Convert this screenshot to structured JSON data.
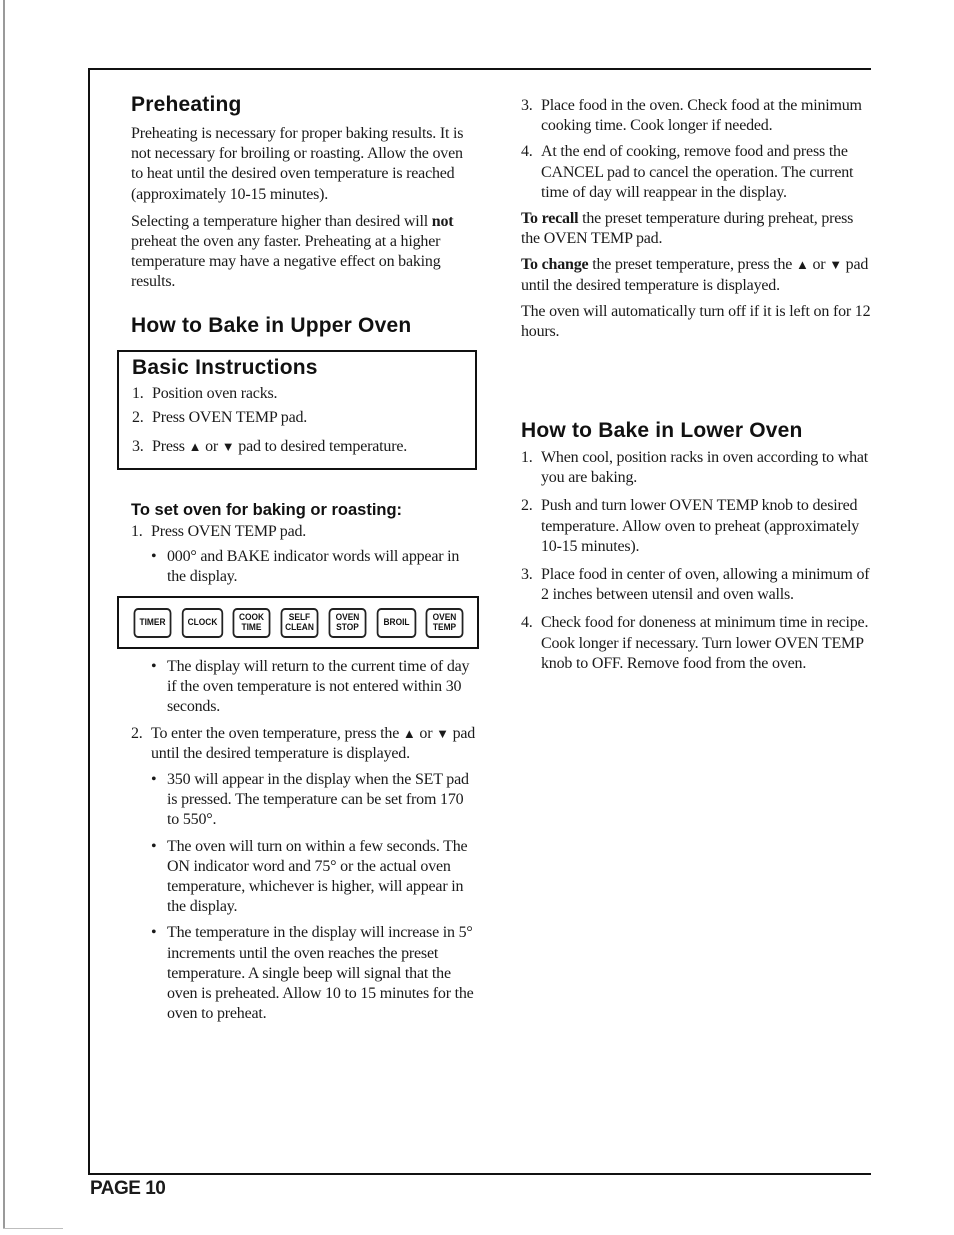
{
  "page": {
    "page_label": "PAGE 10"
  },
  "preheating": {
    "title": "Preheating",
    "para1": "Preheating is necessary for proper baking results. It is not necessary for broiling or roasting. Allow the oven to heat until the desired oven temperature is reached (approximately 10-15 minutes).",
    "para2_bold": "not",
    "para2_before": "Selecting a temperature higher than desired will ",
    "para2_after": " preheat the oven any faster. Preheating at a higher temperature may have a negative effect on baking results."
  },
  "upper_oven": {
    "title": "How to Bake in Upper Oven",
    "basic": {
      "title": "Basic Instructions",
      "steps": [
        {
          "num": "1.",
          "text": "Position oven racks."
        },
        {
          "num": "2.",
          "text": "Press OVEN TEMP pad."
        },
        {
          "num": "3.",
          "before": "Press ",
          "up": "▲",
          "mid": " or ",
          "down": "▼",
          "after": " pad to desired temperature."
        }
      ]
    },
    "set_oven": {
      "title": "To set oven for baking or roasting:",
      "step1": {
        "num": "1.",
        "text": "Press OVEN TEMP pad."
      },
      "bullet1": "000° and BAKE indicator words will appear in the display.",
      "pads": [
        {
          "line1": "TIMER",
          "line2": ""
        },
        {
          "line1": "CLOCK",
          "line2": ""
        },
        {
          "line1": "COOK",
          "line2": "TIME"
        },
        {
          "line1": "SELF",
          "line2": "CLEAN"
        },
        {
          "line1": "OVEN",
          "line2": "STOP"
        },
        {
          "line1": "BROIL",
          "line2": ""
        },
        {
          "line1": "OVEN",
          "line2": "TEMP"
        }
      ],
      "bullet2": "The display will return to the current time of day if the oven temperature is not entered within 30 seconds.",
      "step2": {
        "num": "2.",
        "before": "To enter the oven temperature, press the ",
        "up": "▲",
        "mid": " or ",
        "down": "▼",
        "after": " pad until the desired temperature is displayed."
      },
      "bullet3": "350 will appear in the display when the SET pad is pressed. The temperature can be set from 170 to 550°.",
      "bullet4": "The oven will turn on within a few seconds. The ON indicator word and 75° or the actual oven temperature, whichever is higher, will appear in the display.",
      "bullet5": "The temperature in the display will increase in 5° increments until the oven reaches the preset temperature. A single beep will signal that the oven is preheated. Allow 10 to 15 minutes for the oven to preheat.",
      "step3": {
        "num": "3.",
        "text": "Place food in the oven. Check food at the minimum cooking time. Cook longer if needed."
      },
      "step4": {
        "num": "4.",
        "text": "At the end of cooking, remove food and press the CANCEL pad to cancel the operation. The current time of day will reappear in the display."
      }
    },
    "recall": {
      "bold": "To recall",
      "text": " the preset temperature during preheat, press the OVEN TEMP pad."
    },
    "change": {
      "bold": "To change",
      "before": " the preset temperature, press the ",
      "up": "▲",
      "mid": " or ",
      "down": "▼",
      "after": " pad until the desired temperature is displayed."
    },
    "auto_off": "The oven will automatically turn off if it is left on for 12 hours."
  },
  "lower_oven": {
    "title": "How to Bake in Lower Oven",
    "steps": [
      {
        "num": "1.",
        "text": "When cool, position racks in oven according to what you are baking."
      },
      {
        "num": "2.",
        "text": "Push and turn lower OVEN TEMP knob to desired temperature. Allow oven to preheat (approximately 10-15 minutes)."
      },
      {
        "num": "3.",
        "text": "Place food in center of oven, allowing a minimum of 2 inches between utensil and oven walls."
      },
      {
        "num": "4.",
        "text": "Check food for doneness at minimum time in recipe. Cook longer if necessary. Turn lower OVEN TEMP knob to OFF. Remove food from the oven."
      }
    ]
  },
  "bullet_glyph": "•"
}
